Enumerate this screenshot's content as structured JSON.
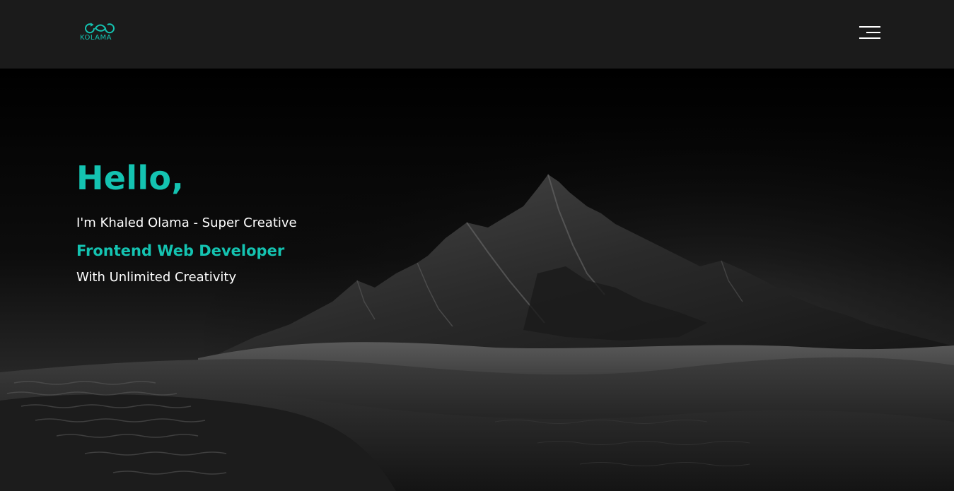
{
  "header": {
    "logo_text": "KOLAMA",
    "brand_color": "#14c3b1",
    "menu_icon": "hamburger-menu-icon"
  },
  "hero": {
    "greeting": "Hello,",
    "intro": "I'm Khaled Olama - Super Creative",
    "role": "Frontend Web Developer",
    "tagline": "With Unlimited Creativity",
    "background": "mountain-desert-landscape-image"
  },
  "colors": {
    "accent": "#14c3b1",
    "header_bg": "#1b1b1b",
    "text": "#ffffff"
  }
}
